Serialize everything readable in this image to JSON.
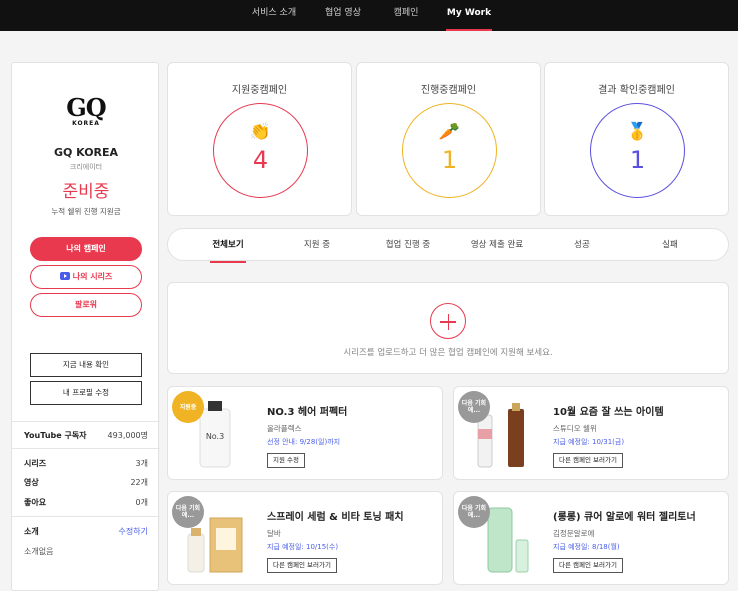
{
  "nav": {
    "items": [
      {
        "label": "서비스 소개"
      },
      {
        "label": "협업 영상"
      },
      {
        "label": "캠페인"
      },
      {
        "label": "My Work"
      }
    ]
  },
  "profile": {
    "logo_main": "GQ",
    "logo_sub": "KOREA",
    "name": "GQ KOREA",
    "role": "크리에이터",
    "amount": "준비중",
    "amount_caption": "누적 쉘위 진행 지원금",
    "btn_my_campaign": "나의 캠페인",
    "btn_my_series": "나의 시리즈",
    "btn_follower": "팔로워",
    "btn_check": "지금 내용 확인",
    "btn_edit": "내 프로필 수정",
    "stats": {
      "subscribers_label": "YouTube 구독자",
      "subscribers_value": "493,000명",
      "series_label": "시리즈",
      "series_value": "3개",
      "video_label": "영상",
      "video_value": "22개",
      "likes_label": "좋아요",
      "likes_value": "0개"
    },
    "intro_label": "소개",
    "intro_edit": "수정하기",
    "intro_text": "소개없음"
  },
  "summary": [
    {
      "title": "지원중캠페인",
      "emoji": "👏",
      "value": "4",
      "color": "#e8394f"
    },
    {
      "title": "진행중캠페인",
      "emoji": "🥕",
      "value": "1",
      "color": "#f0b323"
    },
    {
      "title": "결과 확인중캠페인",
      "emoji": "🥇",
      "value": "1",
      "color": "#5a4fe0"
    }
  ],
  "tabs": [
    {
      "label": "전체보기"
    },
    {
      "label": "지원 중"
    },
    {
      "label": "협업 진행 중"
    },
    {
      "label": "영상 제출 완료"
    },
    {
      "label": "성공"
    },
    {
      "label": "실패"
    }
  ],
  "upload": {
    "hint": "시리즈를 업로드하고 더 많은 협업 캠페인에 지원해 보세요."
  },
  "campaigns": [
    {
      "badge": "지원중",
      "badge_color": "#f0b323",
      "name": "NO.3 헤어 퍼펙터",
      "brand": "올라플렉스",
      "date": "선정 안내: 9/28(일)까지",
      "action": "지원 수정"
    },
    {
      "badge": "다음 기회에...",
      "badge_color": "#999999",
      "name": "10월 요즘 잘 쓰는 아이템",
      "brand": "스튜디오 쉘위",
      "date": "지급 예정일: 10/31(금)",
      "action": "다른 캠페인 보러가기"
    },
    {
      "badge": "다음 기회에...",
      "badge_color": "#999999",
      "name": "스프레이 세럼 & 비타 토닝 패치",
      "brand": "달바",
      "date": "지급 예정일: 10/15(수)",
      "action": "다른 캠페인 보러가기"
    },
    {
      "badge": "다음 기회에...",
      "badge_color": "#999999",
      "name": "(롱롱) 큐어 알로에 워터 젤리토너",
      "brand": "김정문알로에",
      "date": "지급 예정일: 8/18(월)",
      "action": "다른 캠페인 보러가기"
    }
  ]
}
